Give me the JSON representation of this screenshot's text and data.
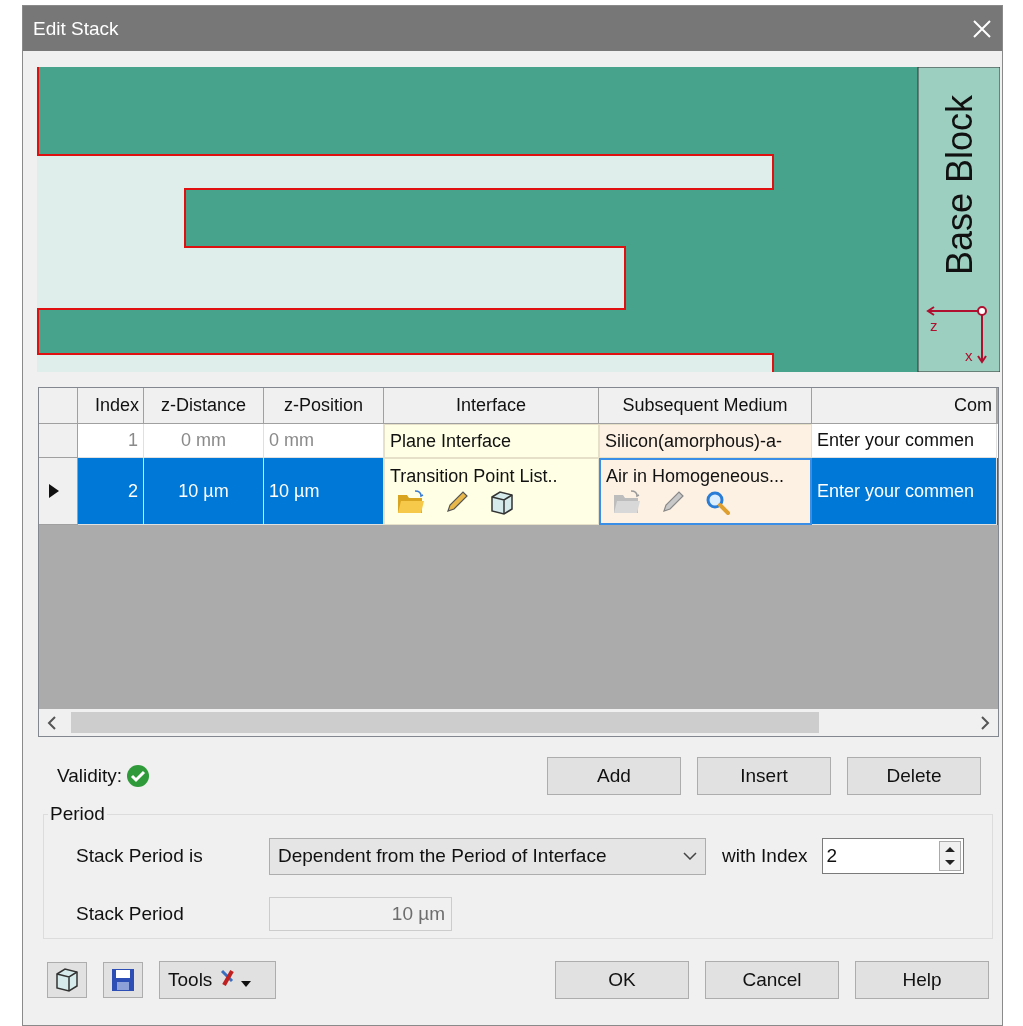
{
  "window": {
    "title": "Edit Stack"
  },
  "preview": {
    "base_label": "Base Block",
    "axis_labels": [
      "z",
      "x"
    ]
  },
  "table": {
    "columns": [
      "Index",
      "z-Distance",
      "z-Position",
      "Interface",
      "Subsequent Medium",
      "Com"
    ],
    "rows": [
      {
        "selected": false,
        "dimmed": true,
        "index": "1",
        "z_distance": "0 mm",
        "z_position": "0 mm",
        "interface": {
          "text": "Plane Interface",
          "focused": false
        },
        "medium": {
          "text": "Silicon(amorphous)-a-",
          "focused": false
        },
        "comment": "Enter your commen"
      },
      {
        "selected": true,
        "dimmed": false,
        "index": "2",
        "z_distance": "10 µm",
        "z_position": "10 µm",
        "interface": {
          "text": "Transition Point List..",
          "focused": false,
          "tools": [
            {
              "kind": "open",
              "disabled": false
            },
            {
              "kind": "edit",
              "disabled": false
            },
            {
              "kind": "view3d",
              "disabled": false
            }
          ]
        },
        "medium": {
          "text": "Air in Homogeneous...",
          "focused": true,
          "tools": [
            {
              "kind": "open",
              "disabled": true
            },
            {
              "kind": "edit",
              "disabled": true
            },
            {
              "kind": "search",
              "disabled": false
            }
          ]
        },
        "comment": "Enter your commen"
      }
    ]
  },
  "validity": {
    "label": "Validity:",
    "valid": true
  },
  "row_buttons": [
    "Add",
    "Insert",
    "Delete"
  ],
  "period": {
    "legend": "Period",
    "mode_label": "Stack Period is",
    "mode_value": "Dependent from the Period of Interface",
    "index_label": "with Index",
    "index_value": "2",
    "period_label": "Stack Period",
    "period_value": "10 µm"
  },
  "footer": {
    "tools_label": "Tools",
    "buttons": [
      "OK",
      "Cancel",
      "Help"
    ]
  }
}
